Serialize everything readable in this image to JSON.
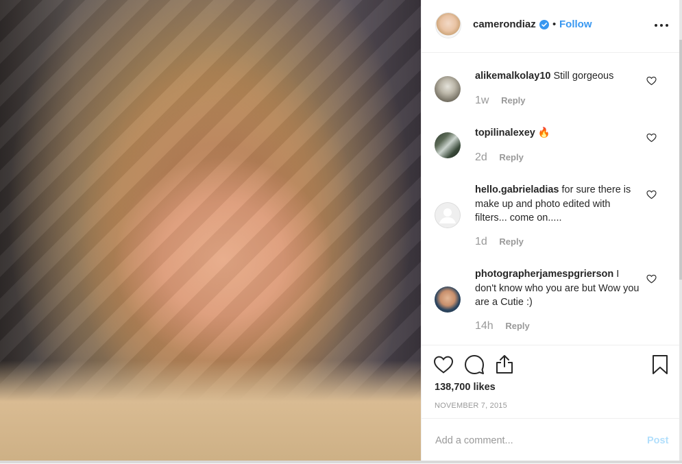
{
  "post": {
    "photo_alt": "Selfie photo of a smiling woman with long blonde hair",
    "username": "camerondiaz",
    "verified": true,
    "separator": "•",
    "follow_label": "Follow",
    "more_icon": "more-options-icon"
  },
  "comments": [
    {
      "username": "alikemalkolay10",
      "text": "Still gorgeous",
      "age": "1w",
      "reply_label": "Reply"
    },
    {
      "username": "topilinalexey",
      "text": "🔥",
      "age": "2d",
      "reply_label": "Reply"
    },
    {
      "username": "hello.gabrieladias",
      "text": "for sure there is make up and photo edited with filters... come on.....",
      "age": "1d",
      "reply_label": "Reply"
    },
    {
      "username": "photographerjamespgrierson",
      "text": "I don't know who you are but Wow you are a Cutie :)",
      "age": "14h",
      "reply_label": "Reply"
    }
  ],
  "actions": {
    "icons": [
      "heart-icon",
      "comment-icon",
      "share-icon",
      "bookmark-icon"
    ],
    "likes": "138,700 likes",
    "date": "NOVEMBER 7, 2015"
  },
  "comment_box": {
    "placeholder": "Add a comment...",
    "post_label": "Post"
  },
  "colors": {
    "accent": "#3897f0",
    "post_disabled": "#b2dffc",
    "muted_text": "#999999",
    "border": "#efefef"
  }
}
